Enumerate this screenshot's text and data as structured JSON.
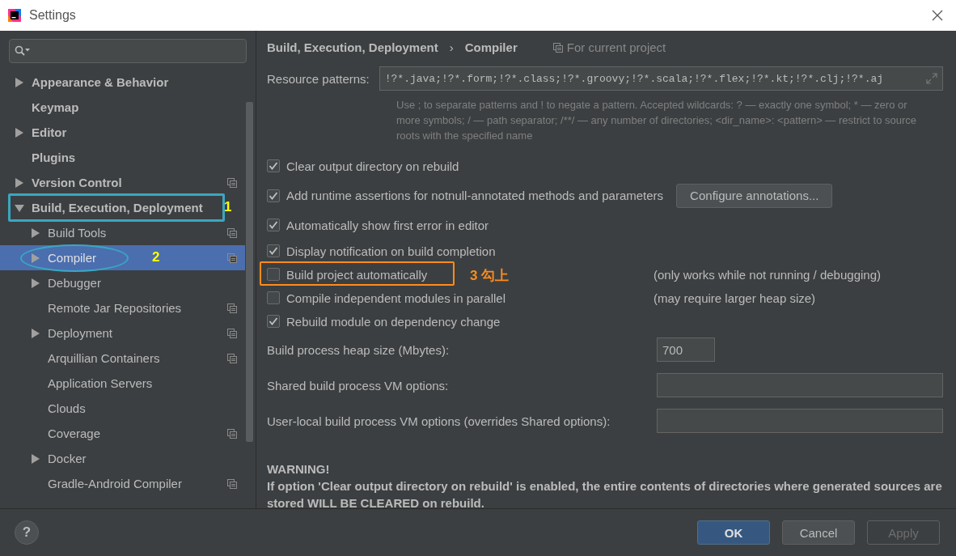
{
  "window": {
    "title": "Settings"
  },
  "tree": [
    {
      "label": "Appearance & Behavior",
      "expanded": false,
      "selected": false,
      "project_level": false
    },
    {
      "label": "Keymap",
      "selected": false,
      "project_level": false
    },
    {
      "label": "Editor",
      "expanded": false,
      "selected": false,
      "project_level": false
    },
    {
      "label": "Plugins",
      "selected": false,
      "project_level": false
    },
    {
      "label": "Version Control",
      "expanded": false,
      "selected": false,
      "project_level": true
    },
    {
      "label": "Build, Execution, Deployment",
      "expanded": true,
      "selected": false,
      "project_level": false,
      "annotation": {
        "text": "1",
        "kind": "box",
        "color": "#ffff00"
      },
      "children": [
        {
          "label": "Build Tools",
          "expanded": false,
          "selected": false,
          "project_level": true
        },
        {
          "label": "Compiler",
          "expanded": false,
          "selected": true,
          "project_level": true,
          "annotation": {
            "text": "2",
            "kind": "ellipse",
            "color": "#ffff00"
          }
        },
        {
          "label": "Debugger",
          "expanded": false,
          "selected": false,
          "project_level": false
        },
        {
          "label": "Remote Jar Repositories",
          "selected": false,
          "project_level": true
        },
        {
          "label": "Deployment",
          "expanded": false,
          "selected": false,
          "project_level": true
        },
        {
          "label": "Arquillian Containers",
          "selected": false,
          "project_level": true
        },
        {
          "label": "Application Servers",
          "selected": false,
          "project_level": false
        },
        {
          "label": "Clouds",
          "selected": false,
          "project_level": false
        },
        {
          "label": "Coverage",
          "selected": false,
          "project_level": true
        },
        {
          "label": "Docker",
          "expanded": false,
          "selected": false,
          "project_level": false
        },
        {
          "label": "Gradle-Android Compiler",
          "selected": false,
          "project_level": true
        }
      ]
    }
  ],
  "breadcrumb": {
    "parent": "Build, Execution, Deployment",
    "separator": "›",
    "current": "Compiler",
    "scope": "For current project"
  },
  "resource_patterns": {
    "label": "Resource patterns:",
    "value": "!?*.java;!?*.form;!?*.class;!?*.groovy;!?*.scala;!?*.flex;!?*.kt;!?*.clj;!?*.aj",
    "help": "Use ; to separate patterns and ! to negate a pattern. Accepted wildcards: ? — exactly one symbol; * — zero or more symbols; / — path separator; /**/ — any number of directories; <dir_name>: <pattern> — restrict to source roots with the specified name"
  },
  "options": [
    {
      "label": "Clear output directory on rebuild",
      "checked": true
    },
    {
      "label": "Add runtime assertions for notnull-annotated methods and parameters",
      "checked": true,
      "button": "Configure annotations..."
    },
    {
      "label": "Automatically show first error in editor",
      "checked": true
    },
    {
      "label": "Display notification on build completion",
      "checked": true
    },
    {
      "label": "Build project automatically",
      "checked": false,
      "note": "(only works while not running / debugging)",
      "annotation": {
        "text": "3 勾上",
        "kind": "box",
        "color": "#ff8c1a"
      }
    },
    {
      "label": "Compile independent modules in parallel",
      "checked": false,
      "note": "(may require larger heap size)"
    },
    {
      "label": "Rebuild module on dependency change",
      "checked": true
    }
  ],
  "fields": [
    {
      "label": "Build process heap size (Mbytes):",
      "value": "700",
      "kind": "number"
    },
    {
      "label": "Shared build process VM options:",
      "kind": "text"
    },
    {
      "label": "User-local build process VM options (overrides Shared options):",
      "kind": "text"
    }
  ],
  "warning": {
    "title": "WARNING!",
    "text": "If option 'Clear output directory on rebuild' is enabled, the entire contents of directories where generated sources are stored WILL BE CLEARED on rebuild."
  },
  "help_button": "?",
  "buttons": [
    {
      "label": "OK",
      "kind": "primary"
    },
    {
      "label": "Cancel",
      "kind": "normal"
    },
    {
      "label": "Apply",
      "kind": "disabled"
    }
  ]
}
